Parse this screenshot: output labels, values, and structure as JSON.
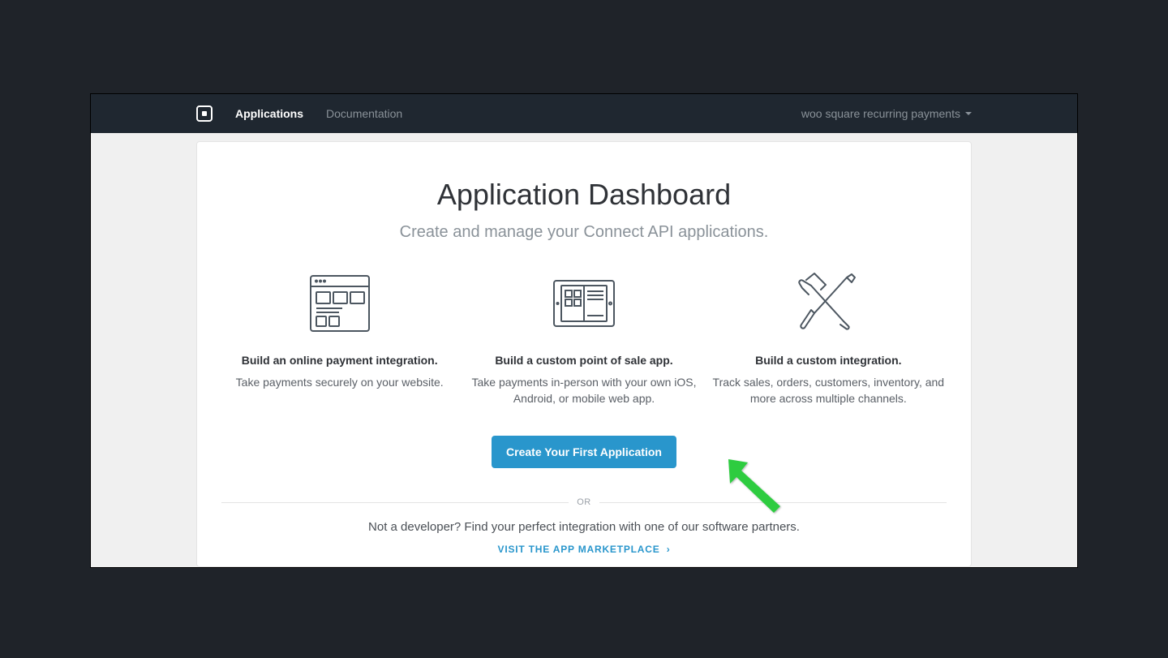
{
  "nav": {
    "applications": "Applications",
    "documentation": "Documentation",
    "account": "woo square recurring payments"
  },
  "header": {
    "title": "Application Dashboard",
    "subtitle": "Create and manage your Connect API applications."
  },
  "columns": [
    {
      "heading": "Build an online payment integration.",
      "desc": "Take payments securely on your website."
    },
    {
      "heading": "Build a custom point of sale app.",
      "desc": "Take payments in-person with your own iOS, Android, or mobile web app."
    },
    {
      "heading": "Build a custom integration.",
      "desc": "Track sales, orders, customers, inventory, and more across multiple channels."
    }
  ],
  "cta": {
    "label": "Create Your First Application"
  },
  "divider": {
    "or": "OR"
  },
  "footer": {
    "not_dev": "Not a developer? Find your perfect integration with one of our software partners.",
    "marketplace": "VISIT THE APP MARKETPLACE"
  }
}
